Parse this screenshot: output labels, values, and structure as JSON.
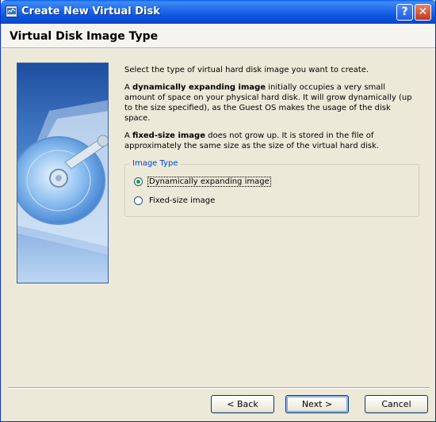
{
  "window": {
    "title": "Create New Virtual Disk",
    "help_glyph": "?",
    "close_glyph": "✕"
  },
  "header": {
    "title": "Virtual Disk Image Type"
  },
  "content": {
    "intro": "Select the type of virtual hard disk image you want to create.",
    "p1_prefix": "A ",
    "p1_bold": "dynamically expanding image",
    "p1_rest": " initially occupies a very small amount of space on your physical hard disk. It will grow dynamically (up to the size specified), as the Guest OS makes the usage of the disk space.",
    "p2_prefix": "A ",
    "p2_bold": "fixed-size image",
    "p2_rest": " does not grow up. It is stored in the file of approximately the same size as the size of the virtual hard disk."
  },
  "image_type": {
    "legend": "Image Type",
    "options": [
      {
        "label": "Dynamically expanding image",
        "selected": true
      },
      {
        "label": "Fixed-size image",
        "selected": false
      }
    ]
  },
  "buttons": {
    "back": "< Back",
    "next": "Next >",
    "cancel": "Cancel"
  },
  "icons": {
    "app": "virtualbox-icon",
    "sidebar": "hard-disk-illustration"
  }
}
